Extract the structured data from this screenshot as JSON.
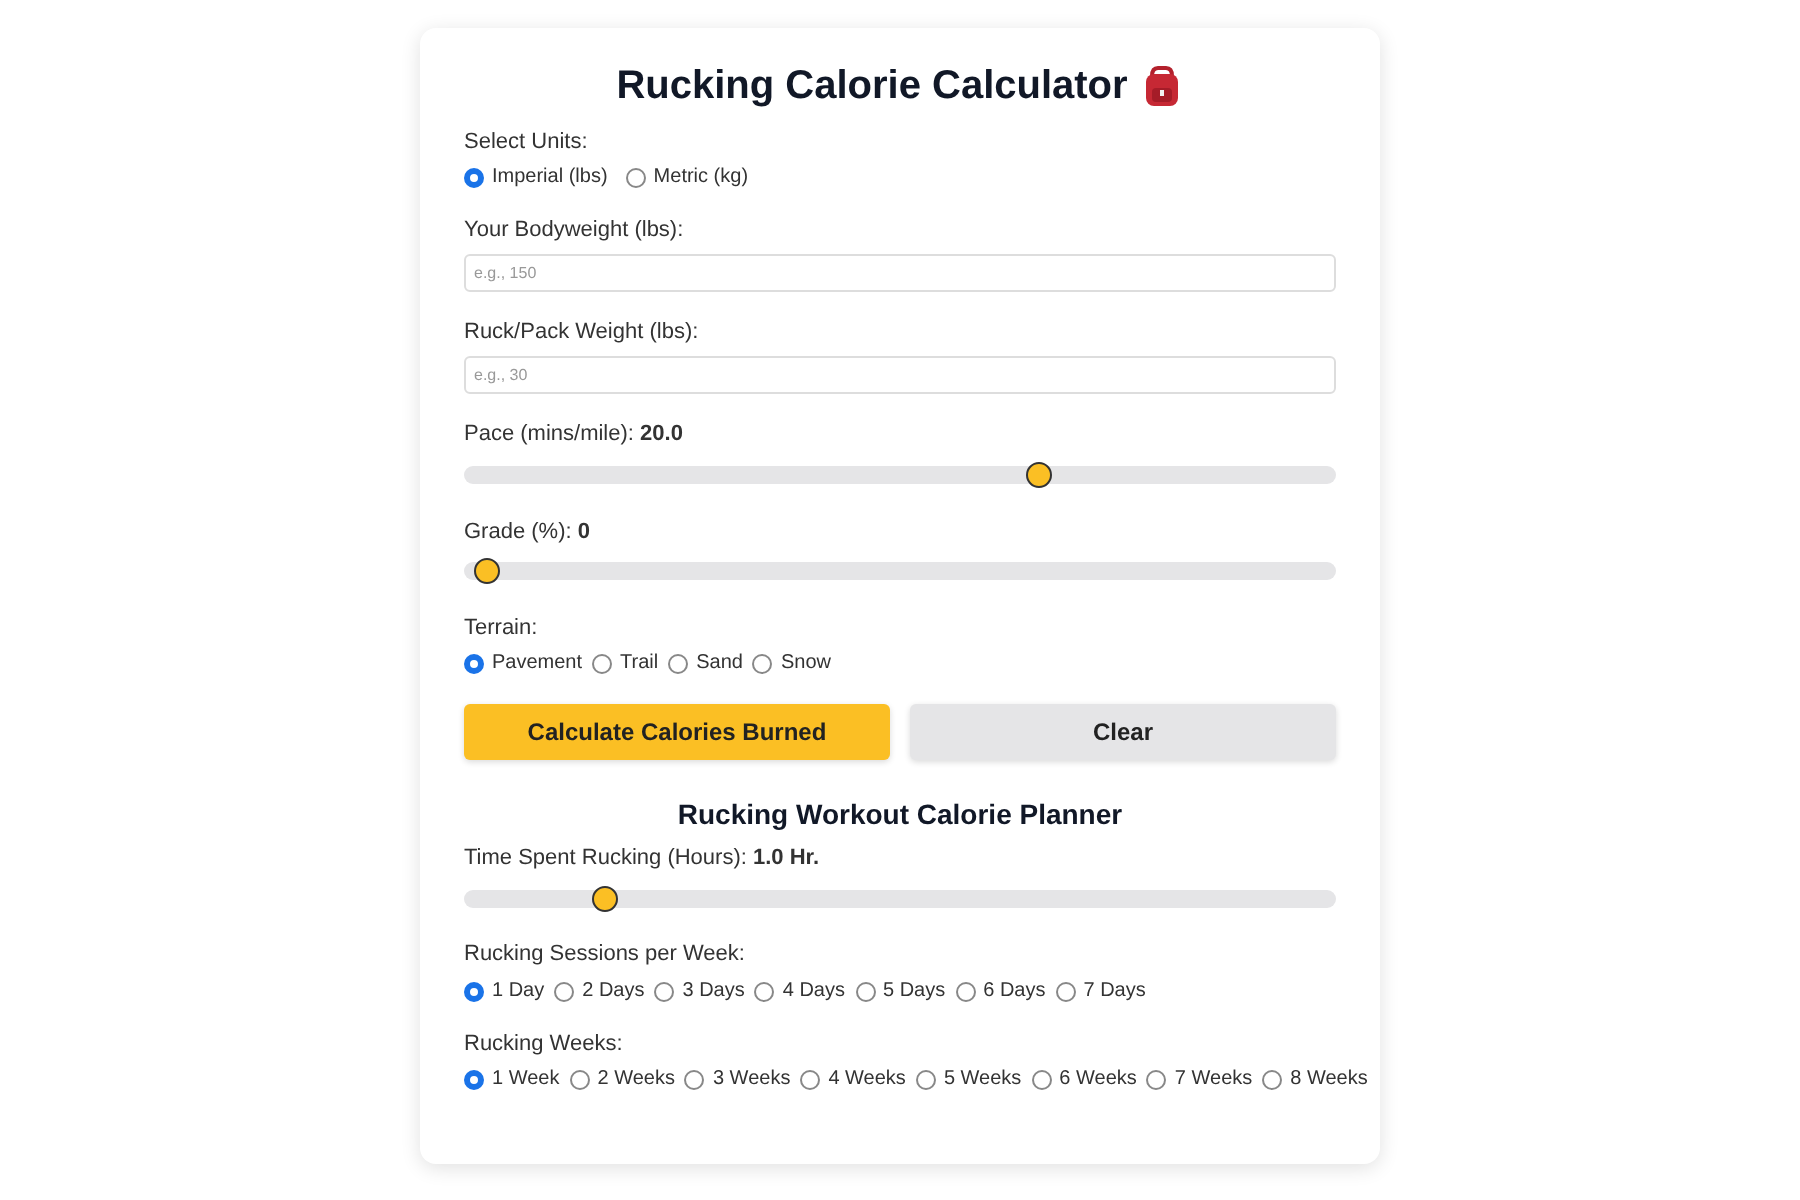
{
  "title": "Rucking Calorie Calculator",
  "units": {
    "label": "Select Units:",
    "options": [
      {
        "label": "Imperial (lbs)",
        "selected": true
      },
      {
        "label": "Metric (kg)",
        "selected": false
      }
    ]
  },
  "bodyweight": {
    "label": "Your Bodyweight (lbs):",
    "placeholder": "e.g., 150"
  },
  "pack_weight": {
    "label": "Ruck/Pack Weight (lbs):",
    "placeholder": "e.g., 30"
  },
  "pace": {
    "label": "Pace (mins/mile):",
    "value": "20.0",
    "level": 0.667
  },
  "grade": {
    "label": "Grade (%):",
    "value": "0",
    "level": 0
  },
  "terrain": {
    "label": "Terrain:",
    "options": [
      {
        "label": "Pavement",
        "selected": true
      },
      {
        "label": "Trail",
        "selected": false
      },
      {
        "label": "Sand",
        "selected": false
      },
      {
        "label": "Snow",
        "selected": false
      }
    ]
  },
  "buttons": [
    {
      "label": "Calculate Calories Burned",
      "kind": "primary"
    },
    {
      "label": "Clear",
      "kind": "secondary"
    }
  ],
  "planner": {
    "title": "Rucking Workout Calorie Planner",
    "time": {
      "label": "Time Spent Rucking (Hours):",
      "value": "1.0 Hr.",
      "level": 0.143
    },
    "sessions": {
      "label": "Rucking Sessions per Week:",
      "options": [
        {
          "label": "1 Day",
          "selected": true
        },
        {
          "label": "2 Days",
          "selected": false
        },
        {
          "label": "3 Days",
          "selected": false
        },
        {
          "label": "4 Days",
          "selected": false
        },
        {
          "label": "5 Days",
          "selected": false
        },
        {
          "label": "6 Days",
          "selected": false
        },
        {
          "label": "7 Days",
          "selected": false
        }
      ]
    },
    "weeks": {
      "label": "Rucking Weeks:",
      "options": [
        {
          "label": "1 Week",
          "selected": true
        },
        {
          "label": "2 Weeks",
          "selected": false
        },
        {
          "label": "3 Weeks",
          "selected": false
        },
        {
          "label": "4 Weeks",
          "selected": false
        },
        {
          "label": "5 Weeks",
          "selected": false
        },
        {
          "label": "6 Weeks",
          "selected": false
        },
        {
          "label": "7 Weeks",
          "selected": false
        },
        {
          "label": "8 Weeks",
          "selected": false
        }
      ]
    }
  }
}
